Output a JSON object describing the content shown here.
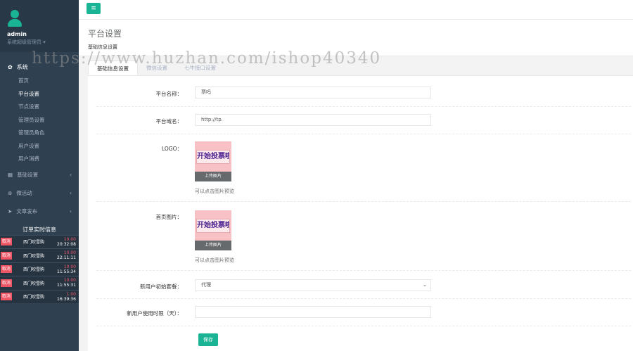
{
  "sidebar": {
    "username": "admin",
    "role": "系统超级管理员 ▾",
    "system_label": "系统",
    "system_items": [
      "首页",
      "平台设置",
      "节点设置",
      "管理员设置",
      "管理员角色",
      "用户设置",
      "用户消费"
    ],
    "other_menus": [
      {
        "label": "基础设置",
        "icon": "grid-icon"
      },
      {
        "label": "微活动",
        "icon": "globe-icon"
      },
      {
        "label": "文章发布",
        "icon": "paper-plane-icon"
      }
    ],
    "orders_title": "订单实时信息",
    "orders": [
      {
        "tag": "取消",
        "name": "西门吹雪购",
        "amount": "10.00",
        "time": "20:32:08"
      },
      {
        "tag": "取消",
        "name": "西门吹雪购",
        "amount": "10.00",
        "time": "22:11:11"
      },
      {
        "tag": "取消",
        "name": "西门吹雪购",
        "amount": "10.00",
        "time": "11:55:34"
      },
      {
        "tag": "取消",
        "name": "西门吹雪购",
        "amount": "10.00",
        "time": "11:55:31"
      },
      {
        "tag": "取消",
        "name": "西门吹雪购",
        "amount": "1.00",
        "time": "16:39:36"
      }
    ]
  },
  "topbar": {
    "menu_icon": "≡"
  },
  "header": {
    "title": "平台设置",
    "breadcrumb": "基础信息设置"
  },
  "watermark": "https://www.huzhan.com/ishop40340",
  "tabs": [
    "基础信息设置",
    "微信设置",
    "七牛接口设置"
  ],
  "form": {
    "name_label": "平台名称：",
    "name_value": "票吗",
    "domain_label": "平台域名：",
    "domain_value": "http://tp.",
    "logo_label": "LOGO：",
    "logo_image_text": "开始投票啦",
    "logo_upload": "上传图片",
    "logo_hint": "可以点击图片预览",
    "home_label": "首页图片：",
    "home_image_text": "开始投票啦",
    "home_upload": "上传图片",
    "home_hint": "可以点击图片预览",
    "package_label": "新用户初始套餐：",
    "package_value": "代理",
    "trial_label": "新用户使用时限（天）：",
    "trial_value": "",
    "save_label": "保存"
  },
  "colors": {
    "accent": "#1ab394",
    "sidebar": "#2f4050",
    "danger": "#ed5565"
  }
}
